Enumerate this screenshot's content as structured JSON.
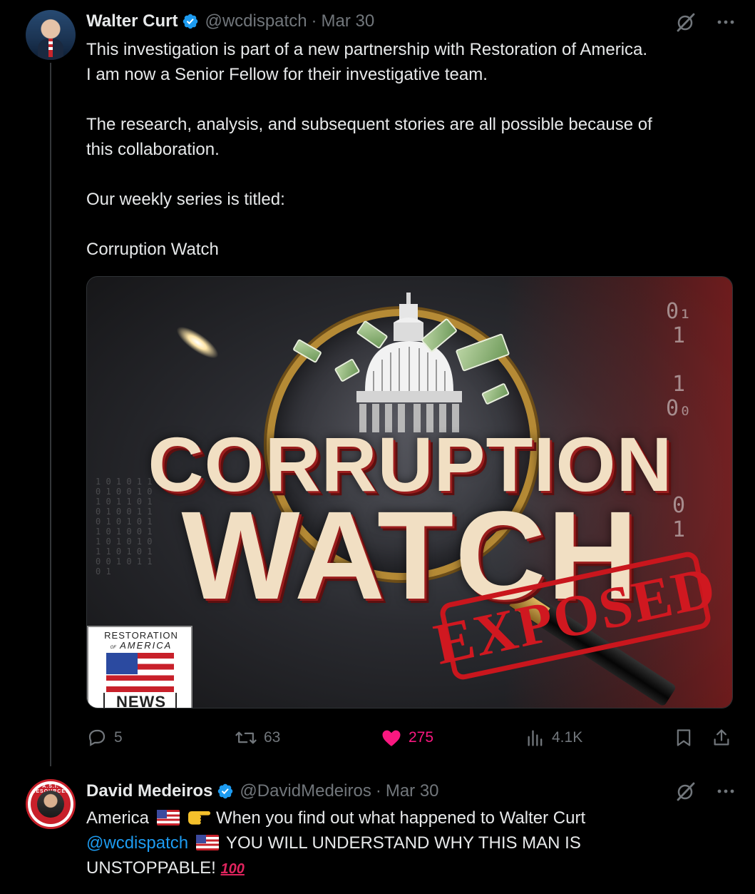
{
  "tweets": [
    {
      "author_name": "Walter Curt",
      "handle": "@wcdispatch",
      "separator": "·",
      "date": "Mar 30",
      "body": [
        "This investigation is part of a new partnership with Restoration of America.",
        "I am now a Senior Fellow for their investigative team.",
        "",
        "The research, analysis, and subsequent stories are all possible because of",
        "this collaboration.",
        "",
        "Our weekly series is titled:",
        "",
        "Corruption Watch"
      ],
      "media": {
        "title_line1": "CORRUPTION",
        "title_line2": "WATCH",
        "stamp": "EXPOSED",
        "logo_line1": "RESTORATION",
        "logo_line2_small": "OF",
        "logo_line2": "AMERICA",
        "logo_line3": "NEWS",
        "binary_right": "0₁\n1\n\n1\n0₀\n\n\n\n0\n1"
      },
      "actions": {
        "replies": "5",
        "reposts": "63",
        "likes": "275",
        "views": "4.1K"
      }
    },
    {
      "author_name": "David Medeiros",
      "handle": "@DavidMedeiros",
      "separator": "·",
      "date": "Mar 30",
      "avatar_badge_text": "A.S.I. RESOURCES",
      "body_line1_a": "America",
      "body_line1_b": "When you find out what happened to Walter Curt",
      "body_line2_mention": "@wcdispatch",
      "body_line2_text": "YOU WILL UNDERSTAND WHY THIS MAN IS",
      "body_line3_text": "UNSTOPPABLE!",
      "body_line3_emoji": "100"
    }
  ],
  "colors": {
    "background": "#000000",
    "text": "#e7e9ea",
    "muted": "#71767b",
    "like_pink": "#f91880",
    "link_blue": "#1d9bf0",
    "verified_blue": "#1d9bf0"
  },
  "icons": {
    "verified": "verified-badge-icon",
    "grok": "grok-icon",
    "more": "more-icon",
    "reply": "reply-icon",
    "repost": "repost-icon",
    "like": "heart-icon",
    "views": "views-icon",
    "bookmark": "bookmark-icon",
    "share": "share-icon"
  }
}
